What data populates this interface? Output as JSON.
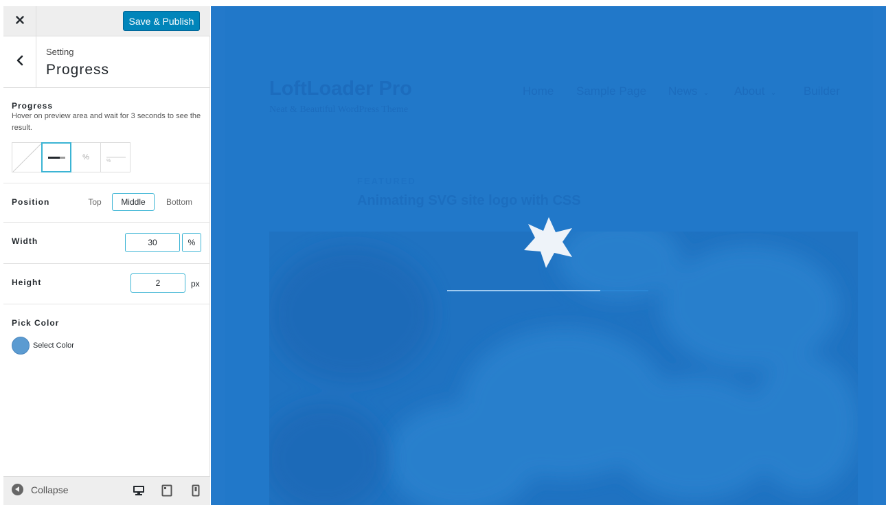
{
  "toolbar": {
    "close_icon": "close-icon",
    "save_label": "Save & Publish",
    "save_color": "#0085ba"
  },
  "section": {
    "crumb": "Setting",
    "title": "Progress",
    "back_icon": "chevron-left-icon"
  },
  "progress_control": {
    "label": "Progress",
    "hint": "Hover on preview area and wait for 3 seconds to see the result.",
    "options": [
      {
        "name": "none",
        "icon": "no-progress-icon"
      },
      {
        "name": "bar",
        "icon": "progress-bar-icon",
        "selected": true
      },
      {
        "name": "percentage",
        "icon": "percentage-icon",
        "glyph": "%"
      },
      {
        "name": "bar-and-percentage",
        "icon": "bar-and-percentage-icon",
        "glyph": "%"
      }
    ]
  },
  "position_control": {
    "label": "Position",
    "options": [
      "Top",
      "Middle",
      "Bottom"
    ],
    "selected": "Middle"
  },
  "width_control": {
    "label": "Width",
    "value": "30",
    "unit": "%"
  },
  "height_control": {
    "label": "Height",
    "value": "2",
    "unit": "px"
  },
  "color_control": {
    "label": "Pick Color",
    "button_label": "Select Color",
    "color": "#5b9bd1"
  },
  "footer": {
    "collapse_label": "Collapse",
    "devices": [
      "desktop-icon",
      "tablet-icon",
      "mobile-icon"
    ]
  },
  "preview": {
    "overlay_color": "#2379ca",
    "site_title": "LoftLoader Pro",
    "tagline": "Neat & Beautiful WordPress Theme",
    "nav": [
      {
        "label": "Home",
        "has_dropdown": false
      },
      {
        "label": "Sample Page",
        "has_dropdown": false
      },
      {
        "label": "News",
        "has_dropdown": true
      },
      {
        "label": "About",
        "has_dropdown": true
      },
      {
        "label": "Builder",
        "has_dropdown": false
      }
    ],
    "featured_label": "FEATURED",
    "post_title": "Animating SVG site logo with CSS",
    "loader_progress": 0.76
  }
}
